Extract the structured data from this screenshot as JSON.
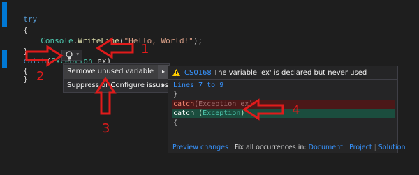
{
  "code": {
    "line1_kw": "try",
    "line2": "{",
    "line3_obj": "Console",
    "line3_dot": ".",
    "line3_method": "WriteLine",
    "line3_open": "(",
    "line3_str": "\"Hello, World!\"",
    "line3_close": ");",
    "line4": "}",
    "line5_kw": "catch",
    "line5_open": "(",
    "line5_type": "Exception",
    "line5_var": " ex",
    "line5_close": ")",
    "line6": "{",
    "line7": "}"
  },
  "quick_actions": {
    "icon": "lightbulb-icon",
    "caret": "▾"
  },
  "menu": {
    "items": [
      {
        "label": "Remove unused variable",
        "arrow": "▸"
      },
      {
        "label": "Suppress or Configure issues",
        "arrow": "▸"
      }
    ]
  },
  "preview": {
    "diag_code": "CS0168",
    "diag_message": "The variable 'ex' is declared but never used",
    "lines_label": "Lines 7 to 9",
    "brace_close": "}",
    "removed_kw": "catch",
    "removed_rest": "(Exception ex)",
    "added_kw": "catch",
    "added_open": " (",
    "added_type": "Exception",
    "added_close": ")",
    "brace_open": "{",
    "footer": {
      "preview_changes": "Preview changes",
      "fix_all": "Fix all occurrences in:",
      "document": "Document",
      "project": "Project",
      "solution": "Solution",
      "sep": "|"
    }
  },
  "annotations": {
    "n1": "1",
    "n2": "2",
    "n3": "3",
    "n4": "4",
    "color": "#e01b1b"
  }
}
